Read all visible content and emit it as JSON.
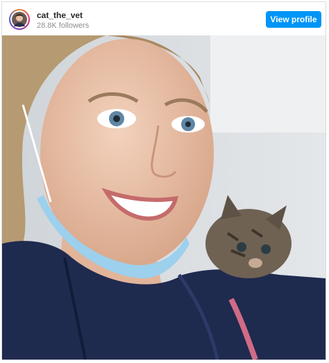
{
  "post": {
    "username": "cat_the_vet",
    "followers": "28.8K followers",
    "view_profile_label": "View profile"
  },
  "colors": {
    "accent": "#0095f6",
    "username": "#262626",
    "secondary_text": "#8e8e8e"
  },
  "icons": {
    "avatar": "profile-photo"
  }
}
